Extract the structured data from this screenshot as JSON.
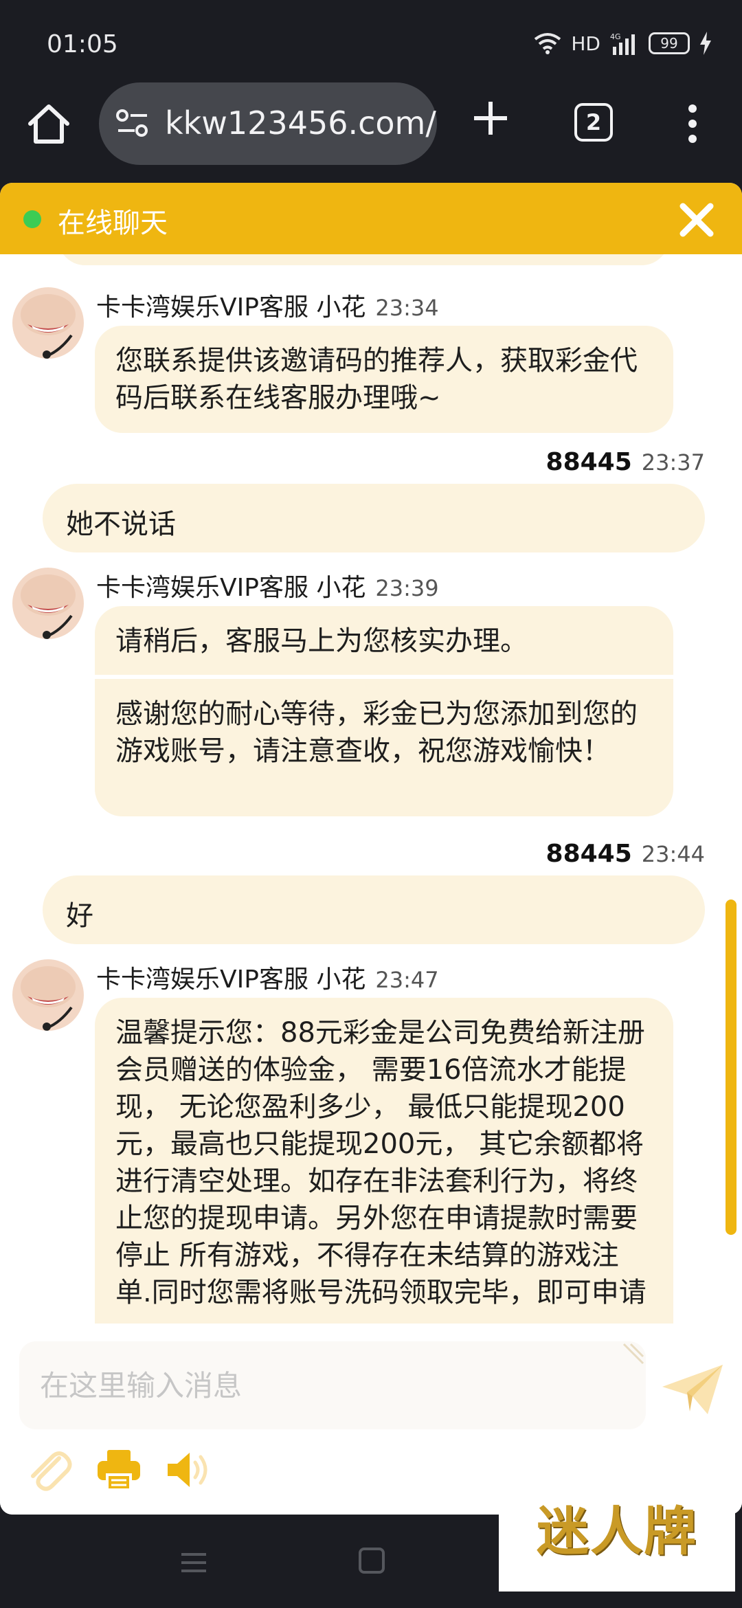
{
  "status_bar": {
    "time": "01:05",
    "hd": "HD",
    "network": "4G",
    "battery": "99"
  },
  "browser": {
    "url": "kkw123456.com/",
    "tab_count": "2"
  },
  "chat": {
    "title": "在线聊天",
    "messages": [
      {
        "sender": "卡卡湾娱乐VIP客服 小花",
        "time": "23:34",
        "bubbles": [
          "您联系提供该邀请码的推荐人，获取彩金代码后联系在线客服办理哦~"
        ]
      },
      {
        "sender": "88445",
        "time": "23:37",
        "text": "她不说话"
      },
      {
        "sender": "卡卡湾娱乐VIP客服 小花",
        "time": "23:39",
        "bubbles": [
          "请稍后，客服马上为您核实办理。",
          "感谢您的耐心等待，彩金已为您添加到您的游戏账号，请注意查收，祝您游戏愉快！"
        ]
      },
      {
        "sender": "88445",
        "time": "23:44",
        "text": "好"
      },
      {
        "sender": "卡卡湾娱乐VIP客服 小花",
        "time": "23:47",
        "bubbles": [
          "温馨提示您：88元彩金是公司免费给新注册会员赠送的体验金， 需要16倍流水才能提现， 无论您盈利多少， 最低只能提现200元，最高也只能提现200元， 其它余额都将进行清空处理。如存在非法套利行为，将终止您的提现申请。另外您在申请提款时需要停止  所有游戏，不得存在未结算的游戏注单.同时您需将账号洗码领取完毕，即可申请"
        ]
      }
    ],
    "input_placeholder": "在这里输入消息"
  },
  "watermark": "迷人牌",
  "colors": {
    "header": "#efb611",
    "bubble": "#fcf3de",
    "online": "#3dcc54",
    "background": "#1b1c22"
  }
}
